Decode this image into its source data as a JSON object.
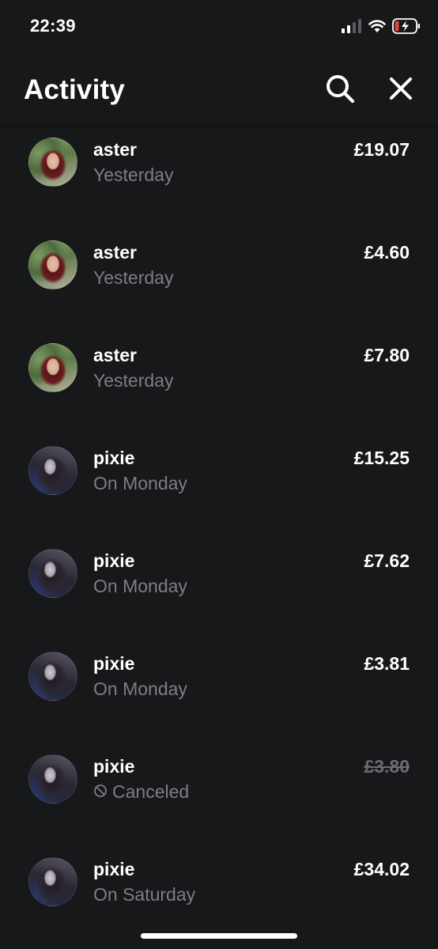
{
  "status_bar": {
    "time": "22:39",
    "signal_icon": "signal-bars-icon",
    "wifi_icon": "wifi-icon",
    "battery_icon": "battery-charging-icon",
    "battery_color": "#e0443a"
  },
  "header": {
    "title": "Activity",
    "search_icon": "search-icon",
    "close_icon": "close-icon"
  },
  "activity": [
    {
      "name": "aster",
      "time": "Yesterday",
      "amount": "£19.07",
      "avatar": "aster",
      "status": "completed"
    },
    {
      "name": "aster",
      "time": "Yesterday",
      "amount": "£4.60",
      "avatar": "aster",
      "status": "completed"
    },
    {
      "name": "aster",
      "time": "Yesterday",
      "amount": "£7.80",
      "avatar": "aster",
      "status": "completed"
    },
    {
      "name": "pixie",
      "time": "On Monday",
      "amount": "£15.25",
      "avatar": "pixie",
      "status": "completed"
    },
    {
      "name": "pixie",
      "time": "On Monday",
      "amount": "£7.62",
      "avatar": "pixie",
      "status": "completed"
    },
    {
      "name": "pixie",
      "time": "On Monday",
      "amount": "£3.81",
      "avatar": "pixie",
      "status": "completed"
    },
    {
      "name": "pixie",
      "time": "Canceled",
      "amount": "£3.80",
      "avatar": "pixie",
      "status": "canceled",
      "icon": "canceled-icon"
    },
    {
      "name": "pixie",
      "time": "On Saturday",
      "amount": "£34.02",
      "avatar": "pixie",
      "status": "completed"
    }
  ]
}
